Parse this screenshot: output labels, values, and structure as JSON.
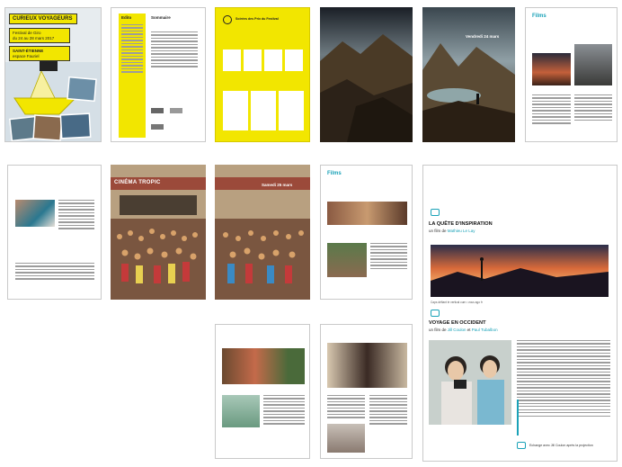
{
  "cover": {
    "title": "CURIEUX VOYAGEURS",
    "subtitle_line1": "Festival de Giro",
    "subtitle_line2": "du 24 au 28 mars 2017",
    "city_line1": "SAINT-ÉTIENNE",
    "city_line2": "espace Fauriel"
  },
  "edito_page": {
    "edito": "Edito",
    "sommaire": "Sommaire"
  },
  "yellow_page": {
    "heading": "Soirées des Prix du Festival"
  },
  "mountain_page": {
    "date": "Vendredi 24 mars"
  },
  "films_page_1": {
    "heading": "Films"
  },
  "cinema_page": {
    "sign": "CINÉMA TROPIC",
    "date": "Samedi 25 mars"
  },
  "films_page_2": {
    "heading": "Films"
  },
  "big_page": {
    "film1_title": "LA QUÊTE D'INSPIRATION",
    "film1_by_prefix": "un film de ",
    "film1_by_name": "Mathieu Le Lay",
    "film1_caption": "Caps défiant le vertical cum • vous ago fr",
    "film2_title": "VOYAGE EN OCCIDENT",
    "film2_by_prefix": "un film de ",
    "film2_by_name1": "Jill Coulon",
    "film2_by_sep": " et ",
    "film2_by_name2": "Paul Tubalbon",
    "footer": "Echange avec Jill Coulon après la projection"
  }
}
